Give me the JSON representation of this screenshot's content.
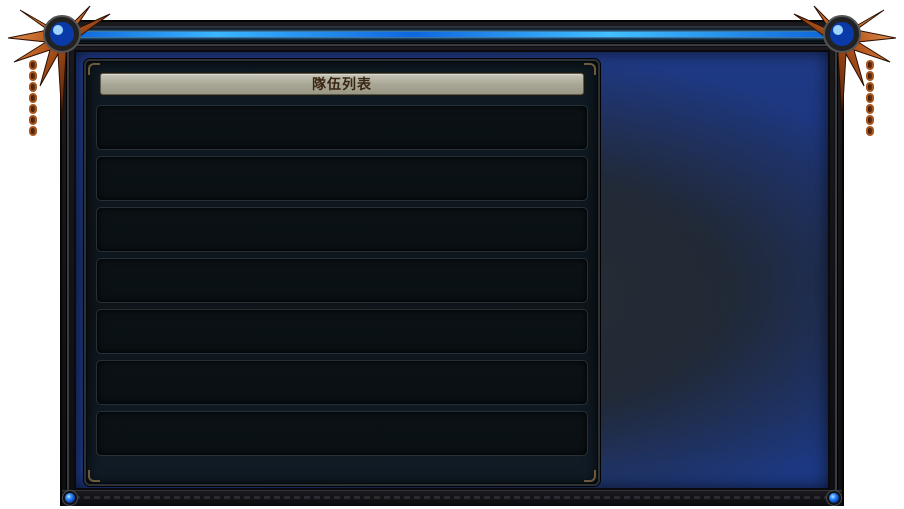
{
  "window": {
    "title": "",
    "accent_color": "#2aa0ff",
    "frame_color": "#1a1a1e",
    "background_color": "#1d3a86",
    "ornament_color": "#a8561f"
  },
  "team_panel": {
    "title": "隊伍列表",
    "title_color": "#3a2612",
    "slots": [
      {
        "label": ""
      },
      {
        "label": ""
      },
      {
        "label": ""
      },
      {
        "label": ""
      },
      {
        "label": ""
      },
      {
        "label": ""
      },
      {
        "label": ""
      }
    ]
  },
  "icons": {
    "corner_left": "spiked-ornament-icon",
    "corner_right": "spiked-ornament-icon",
    "gem": "blue-gem-icon",
    "chain": "chain-icon"
  }
}
